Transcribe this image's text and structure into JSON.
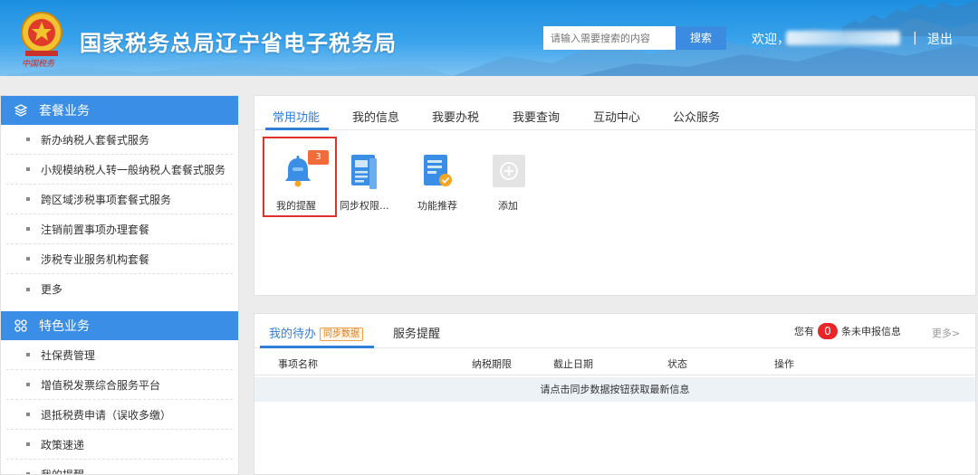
{
  "header": {
    "title": "国家税务总局辽宁省电子税务局",
    "search_placeholder": "请输入需要搜索的内容",
    "search_button": "搜索",
    "welcome": "欢迎，",
    "separator": "|",
    "logout": "退出"
  },
  "sidebar": {
    "sections": [
      {
        "title": "套餐业务",
        "icon": "layers-icon",
        "items": [
          "新办纳税人套餐式服务",
          "小规模纳税人转一般纳税人套餐式服务",
          "跨区域涉税事项套餐式服务",
          "注销前置事项办理套餐",
          "涉税专业服务机构套餐",
          "更多"
        ]
      },
      {
        "title": "特色业务",
        "icon": "grid-icon",
        "items": [
          "社保费管理",
          "增值税发票综合服务平台",
          "退抵税费申请（误收多缴）",
          "政策速递",
          "我的提醒"
        ]
      }
    ]
  },
  "main": {
    "tabs": [
      "常用功能",
      "我的信息",
      "我要办税",
      "我要查询",
      "互动中心",
      "公众服务"
    ],
    "active_tab": 0,
    "functions": [
      {
        "label": "我的提醒",
        "icon": "bell-icon",
        "badge": "3"
      },
      {
        "label": "同步权限...",
        "icon": "document-icon"
      },
      {
        "label": "功能推荐",
        "icon": "recommend-icon"
      },
      {
        "label": "添加",
        "icon": "plus-icon"
      }
    ]
  },
  "todo": {
    "tabs": [
      "我的待办",
      "服务提醒"
    ],
    "sync_tag": "同步数据",
    "notice_prefix": "您有",
    "notice_count": "0",
    "notice_suffix": "条未申报信息",
    "more": "更多>",
    "columns": [
      "事项名称",
      "纳税期限",
      "截止日期",
      "状态",
      "操作"
    ],
    "empty_message": "请点击同步数据按钮获取最新信息"
  },
  "colors": {
    "primary": "#3a8ee6",
    "highlight_border": "#e0312a",
    "badge": "#f26b3a",
    "count_badge": "#e8262a"
  }
}
